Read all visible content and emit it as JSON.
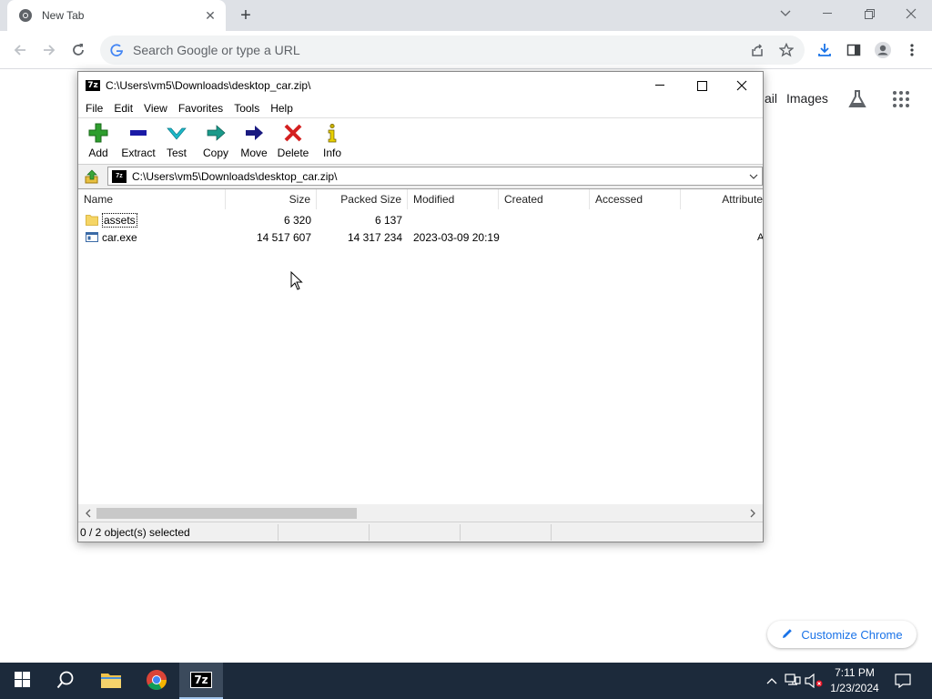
{
  "chrome": {
    "tab_title": "New Tab",
    "omnibox_placeholder": "Search Google or type a URL",
    "ntp_links": [
      "ail",
      "Images"
    ],
    "customize_label": "Customize Chrome"
  },
  "sevenzip": {
    "window_title": "C:\\Users\\vm5\\Downloads\\desktop_car.zip\\",
    "menu": [
      "File",
      "Edit",
      "View",
      "Favorites",
      "Tools",
      "Help"
    ],
    "toolbar": [
      {
        "label": "Add",
        "icon": "add-icon",
        "color": "#2e9e2e"
      },
      {
        "label": "Extract",
        "icon": "extract-icon",
        "color": "#1a1aa6"
      },
      {
        "label": "Test",
        "icon": "test-icon",
        "color": "#1cb8c8"
      },
      {
        "label": "Copy",
        "icon": "copy-icon",
        "color": "#1a9a8a"
      },
      {
        "label": "Move",
        "icon": "move-icon",
        "color": "#1a1a80"
      },
      {
        "label": "Delete",
        "icon": "delete-icon",
        "color": "#d42020"
      },
      {
        "label": "Info",
        "icon": "info-icon",
        "color": "#c8b000"
      }
    ],
    "address": "C:\\Users\\vm5\\Downloads\\desktop_car.zip\\",
    "columns": [
      "Name",
      "Size",
      "Packed Size",
      "Modified",
      "Created",
      "Accessed",
      "Attribute"
    ],
    "rows": [
      {
        "name": "assets",
        "type": "folder",
        "size": "6 320",
        "packed": "6 137",
        "modified": "",
        "created": "",
        "accessed": "",
        "attr": ""
      },
      {
        "name": "car.exe",
        "type": "file",
        "size": "14 517 607",
        "packed": "14 317 234",
        "modified": "2023-03-09 20:19",
        "created": "",
        "accessed": "",
        "attr": "A"
      }
    ],
    "status": "0 / 2 object(s) selected"
  },
  "taskbar": {
    "apps": [
      "start-icon",
      "search-icon",
      "file-explorer-icon",
      "chrome-icon",
      "7zip-icon"
    ],
    "app_7zip_label": "7z",
    "time": "7:11 PM",
    "date": "1/23/2024"
  }
}
